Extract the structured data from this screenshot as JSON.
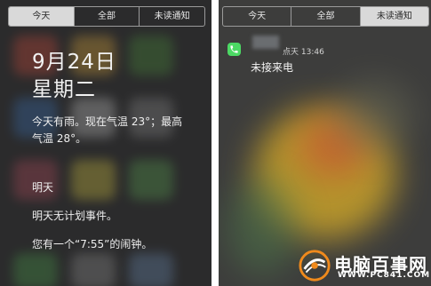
{
  "left": {
    "tabs": [
      {
        "label": "今天",
        "active": true
      },
      {
        "label": "全部",
        "active": false
      },
      {
        "label": "未读通知",
        "active": false
      }
    ],
    "date": "9月24日",
    "weekday": "星期二",
    "weather_line1": "今天有雨。现在气温 23°；最高",
    "weather_line2": "气温 28°。",
    "tomorrow_heading": "明天",
    "no_events": "明天无计划事件。",
    "alarm": "您有一个“7:55”的闹钟。"
  },
  "right": {
    "tabs": [
      {
        "label": "今天",
        "active": false
      },
      {
        "label": "全部",
        "active": false
      },
      {
        "label": "未读通知",
        "active": true
      }
    ],
    "notification": {
      "icon": "phone-icon",
      "time": "点天 13:46",
      "message": "未接来电"
    }
  },
  "watermark": {
    "title": "电脑百事网",
    "url": "WWW.PC841.COM"
  },
  "colors": {
    "accent_green": "#4cd964",
    "watermark_orange": "#f08a1c",
    "panel_dark": "#2b2b2c"
  }
}
